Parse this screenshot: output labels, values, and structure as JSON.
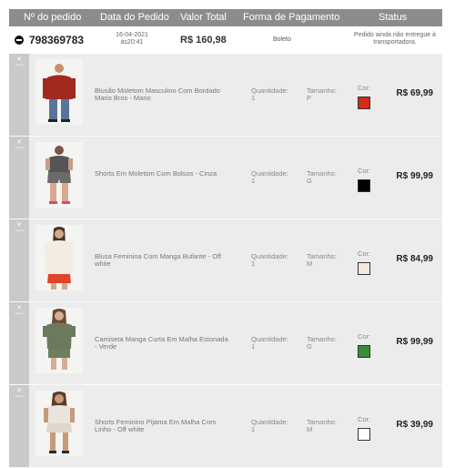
{
  "header": {
    "order_number": "Nº do pedido",
    "order_date": "Data do Pedido",
    "total_value": "Valor Total",
    "payment_method": "Forma de Pagamento",
    "status": "Status"
  },
  "order": {
    "number": "798369783",
    "date": "16-04-2021",
    "time": "às20:41",
    "total": "R$ 160,98",
    "payment": "Boleto",
    "status": "Pedido ainda não entregue à transportadora."
  },
  "item_labels": {
    "quantity": "Quantidade:",
    "size": "Tamanho:",
    "color": "Cor:"
  },
  "store_logo": {
    "icon": "hering-logo-icon",
    "text": "Hering"
  },
  "items": [
    {
      "name": "Blusão Moletom Masculino Com Bordado Mario Bros - Mario",
      "quantity": "1",
      "size": "P",
      "color": "#d42b1a",
      "price": "R$ 69,99"
    },
    {
      "name": "Shorts Em Moletom Com Bolsos - Cinza",
      "quantity": "1",
      "size": "G",
      "color": "#000000",
      "price": "R$ 99,99"
    },
    {
      "name": "Blusa Feminina Com Manga Bufante - Off white",
      "quantity": "1",
      "size": "M",
      "color": "#f3eadf",
      "price": "R$ 84,99"
    },
    {
      "name": "Camiseta Manga Curta Em Malha Estonada - Verde",
      "quantity": "1",
      "size": "G",
      "color": "#3a8b3f",
      "price": "R$ 99,99"
    },
    {
      "name": "Shorts Feminino Pijama Em Malha Com Linho - Off white",
      "quantity": "1",
      "size": "M",
      "color": "#ffffff",
      "price": "R$ 39,99"
    }
  ]
}
